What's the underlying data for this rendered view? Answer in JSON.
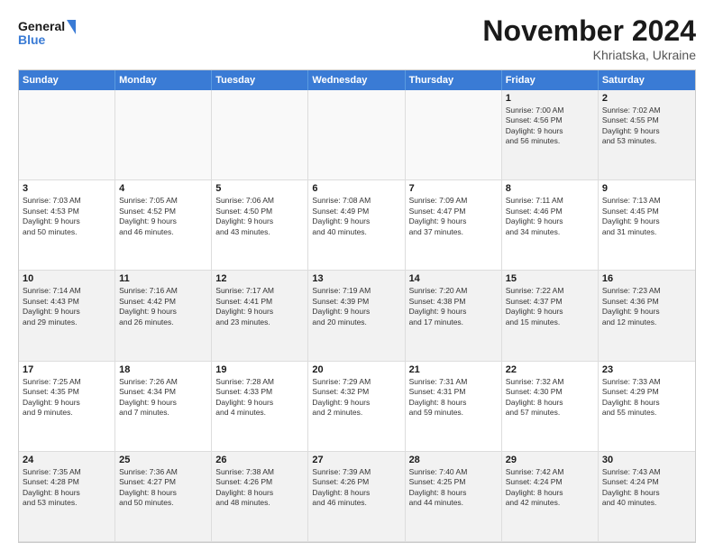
{
  "logo": {
    "line1": "General",
    "line2": "Blue"
  },
  "title": "November 2024",
  "subtitle": "Khriatska, Ukraine",
  "header_days": [
    "Sunday",
    "Monday",
    "Tuesday",
    "Wednesday",
    "Thursday",
    "Friday",
    "Saturday"
  ],
  "weeks": [
    [
      {
        "day": "",
        "info": "",
        "empty": true
      },
      {
        "day": "",
        "info": "",
        "empty": true
      },
      {
        "day": "",
        "info": "",
        "empty": true
      },
      {
        "day": "",
        "info": "",
        "empty": true
      },
      {
        "day": "",
        "info": "",
        "empty": true
      },
      {
        "day": "1",
        "info": "Sunrise: 7:00 AM\nSunset: 4:56 PM\nDaylight: 9 hours\nand 56 minutes.",
        "empty": false
      },
      {
        "day": "2",
        "info": "Sunrise: 7:02 AM\nSunset: 4:55 PM\nDaylight: 9 hours\nand 53 minutes.",
        "empty": false
      }
    ],
    [
      {
        "day": "3",
        "info": "Sunrise: 7:03 AM\nSunset: 4:53 PM\nDaylight: 9 hours\nand 50 minutes.",
        "empty": false
      },
      {
        "day": "4",
        "info": "Sunrise: 7:05 AM\nSunset: 4:52 PM\nDaylight: 9 hours\nand 46 minutes.",
        "empty": false
      },
      {
        "day": "5",
        "info": "Sunrise: 7:06 AM\nSunset: 4:50 PM\nDaylight: 9 hours\nand 43 minutes.",
        "empty": false
      },
      {
        "day": "6",
        "info": "Sunrise: 7:08 AM\nSunset: 4:49 PM\nDaylight: 9 hours\nand 40 minutes.",
        "empty": false
      },
      {
        "day": "7",
        "info": "Sunrise: 7:09 AM\nSunset: 4:47 PM\nDaylight: 9 hours\nand 37 minutes.",
        "empty": false
      },
      {
        "day": "8",
        "info": "Sunrise: 7:11 AM\nSunset: 4:46 PM\nDaylight: 9 hours\nand 34 minutes.",
        "empty": false
      },
      {
        "day": "9",
        "info": "Sunrise: 7:13 AM\nSunset: 4:45 PM\nDaylight: 9 hours\nand 31 minutes.",
        "empty": false
      }
    ],
    [
      {
        "day": "10",
        "info": "Sunrise: 7:14 AM\nSunset: 4:43 PM\nDaylight: 9 hours\nand 29 minutes.",
        "empty": false
      },
      {
        "day": "11",
        "info": "Sunrise: 7:16 AM\nSunset: 4:42 PM\nDaylight: 9 hours\nand 26 minutes.",
        "empty": false
      },
      {
        "day": "12",
        "info": "Sunrise: 7:17 AM\nSunset: 4:41 PM\nDaylight: 9 hours\nand 23 minutes.",
        "empty": false
      },
      {
        "day": "13",
        "info": "Sunrise: 7:19 AM\nSunset: 4:39 PM\nDaylight: 9 hours\nand 20 minutes.",
        "empty": false
      },
      {
        "day": "14",
        "info": "Sunrise: 7:20 AM\nSunset: 4:38 PM\nDaylight: 9 hours\nand 17 minutes.",
        "empty": false
      },
      {
        "day": "15",
        "info": "Sunrise: 7:22 AM\nSunset: 4:37 PM\nDaylight: 9 hours\nand 15 minutes.",
        "empty": false
      },
      {
        "day": "16",
        "info": "Sunrise: 7:23 AM\nSunset: 4:36 PM\nDaylight: 9 hours\nand 12 minutes.",
        "empty": false
      }
    ],
    [
      {
        "day": "17",
        "info": "Sunrise: 7:25 AM\nSunset: 4:35 PM\nDaylight: 9 hours\nand 9 minutes.",
        "empty": false
      },
      {
        "day": "18",
        "info": "Sunrise: 7:26 AM\nSunset: 4:34 PM\nDaylight: 9 hours\nand 7 minutes.",
        "empty": false
      },
      {
        "day": "19",
        "info": "Sunrise: 7:28 AM\nSunset: 4:33 PM\nDaylight: 9 hours\nand 4 minutes.",
        "empty": false
      },
      {
        "day": "20",
        "info": "Sunrise: 7:29 AM\nSunset: 4:32 PM\nDaylight: 9 hours\nand 2 minutes.",
        "empty": false
      },
      {
        "day": "21",
        "info": "Sunrise: 7:31 AM\nSunset: 4:31 PM\nDaylight: 8 hours\nand 59 minutes.",
        "empty": false
      },
      {
        "day": "22",
        "info": "Sunrise: 7:32 AM\nSunset: 4:30 PM\nDaylight: 8 hours\nand 57 minutes.",
        "empty": false
      },
      {
        "day": "23",
        "info": "Sunrise: 7:33 AM\nSunset: 4:29 PM\nDaylight: 8 hours\nand 55 minutes.",
        "empty": false
      }
    ],
    [
      {
        "day": "24",
        "info": "Sunrise: 7:35 AM\nSunset: 4:28 PM\nDaylight: 8 hours\nand 53 minutes.",
        "empty": false
      },
      {
        "day": "25",
        "info": "Sunrise: 7:36 AM\nSunset: 4:27 PM\nDaylight: 8 hours\nand 50 minutes.",
        "empty": false
      },
      {
        "day": "26",
        "info": "Sunrise: 7:38 AM\nSunset: 4:26 PM\nDaylight: 8 hours\nand 48 minutes.",
        "empty": false
      },
      {
        "day": "27",
        "info": "Sunrise: 7:39 AM\nSunset: 4:26 PM\nDaylight: 8 hours\nand 46 minutes.",
        "empty": false
      },
      {
        "day": "28",
        "info": "Sunrise: 7:40 AM\nSunset: 4:25 PM\nDaylight: 8 hours\nand 44 minutes.",
        "empty": false
      },
      {
        "day": "29",
        "info": "Sunrise: 7:42 AM\nSunset: 4:24 PM\nDaylight: 8 hours\nand 42 minutes.",
        "empty": false
      },
      {
        "day": "30",
        "info": "Sunrise: 7:43 AM\nSunset: 4:24 PM\nDaylight: 8 hours\nand 40 minutes.",
        "empty": false
      }
    ]
  ]
}
